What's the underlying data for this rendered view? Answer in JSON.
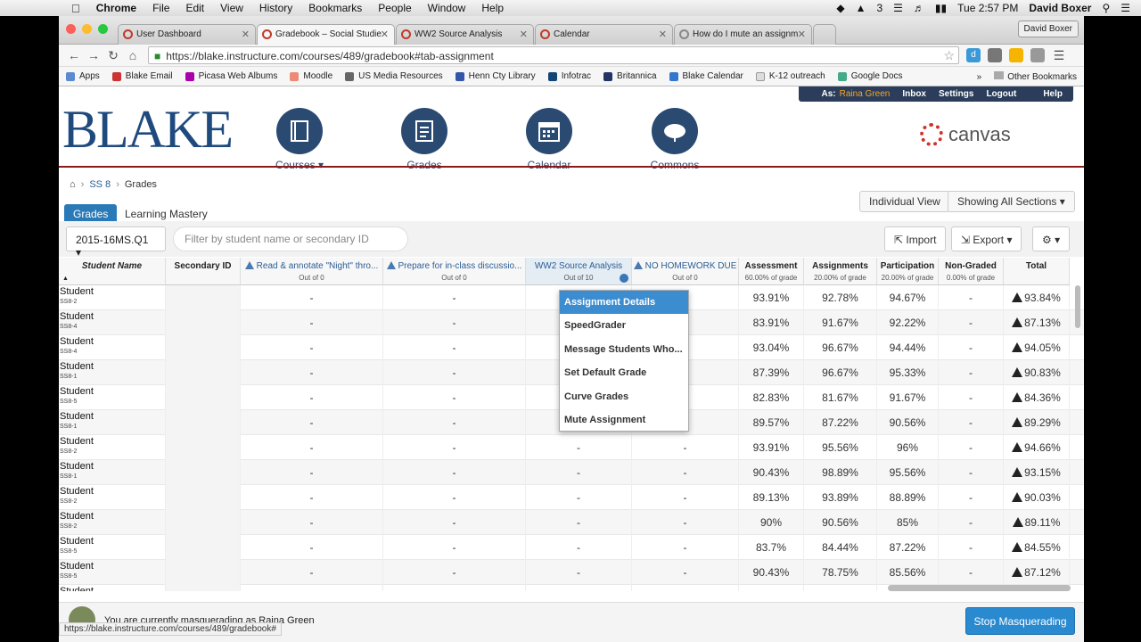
{
  "menubar": {
    "app": "Chrome",
    "items": [
      "File",
      "Edit",
      "View",
      "History",
      "Bookmarks",
      "People",
      "Window",
      "Help"
    ],
    "badge": "3",
    "clock": "Tue 2:57 PM",
    "user": "David Boxer"
  },
  "browser": {
    "tabs": [
      {
        "label": "User Dashboard"
      },
      {
        "label": "Gradebook – Social Studie"
      },
      {
        "label": "WW2 Source Analysis"
      },
      {
        "label": "Calendar"
      },
      {
        "label": "How do I mute an assignm"
      }
    ],
    "profile": "David Boxer",
    "url": "https://blake.instructure.com/courses/489/gradebook#tab-assignment",
    "bookmarks": [
      "Apps",
      "Blake Email",
      "Picasa Web Albums",
      "Moodle",
      "US Media Resources",
      "Henn Cty Library",
      "Infotrac",
      "Britannica",
      "Blake Calendar",
      "K-12 outreach",
      "Google Docs"
    ],
    "more_bookmarks": "»",
    "other_bookmarks": "Other Bookmarks",
    "status_url": "https://blake.instructure.com/courses/489/gradebook#"
  },
  "topnav": {
    "as_label": "As:",
    "as_name": "Raina Green",
    "links": [
      "Inbox",
      "Settings",
      "Logout",
      "Help"
    ]
  },
  "header": {
    "logo": "BLAKE",
    "nav": [
      {
        "label": "Courses",
        "icon": "courses-icon"
      },
      {
        "label": "Grades",
        "icon": "grades-icon"
      },
      {
        "label": "Calendar",
        "icon": "calendar-icon"
      },
      {
        "label": "Commons",
        "icon": "commons-icon"
      }
    ],
    "brand": "canvas",
    "colors": {
      "brand_navy": "#2a4a72",
      "header_rule": "#8b1a1a",
      "accent_blue": "#2a7ab8"
    }
  },
  "breadcrumb": {
    "course": "SS 8",
    "page": "Grades"
  },
  "view": {
    "grades_tab": "Grades",
    "mastery_tab": "Learning Mastery",
    "individual_view": "Individual View",
    "sections": "Showing All Sections"
  },
  "filters": {
    "term": "2015-16MS.Q1",
    "search_placeholder": "Filter by student name or secondary ID",
    "import": "Import",
    "export": "Export"
  },
  "grid": {
    "columns": [
      {
        "title": "Student Name",
        "sub": ""
      },
      {
        "title": "Secondary ID",
        "sub": ""
      },
      {
        "title": "Read & annotate \"Night\" thro...",
        "sub": "Out of 0"
      },
      {
        "title": "Prepare for in-class discussio...",
        "sub": "Out of 0"
      },
      {
        "title": "WW2 Source Analysis",
        "sub": "Out of 10"
      },
      {
        "title": "NO HOMEWORK DUE",
        "sub": "Out of 0"
      },
      {
        "title": "Assessment",
        "sub": "60.00% of grade"
      },
      {
        "title": "Assignments",
        "sub": "20.00% of grade"
      },
      {
        "title": "Participation",
        "sub": "20.00% of grade"
      },
      {
        "title": "Non-Graded",
        "sub": "0.00% of grade"
      },
      {
        "title": "Total",
        "sub": ""
      }
    ],
    "rows": [
      {
        "name": "Student",
        "section": "SS8-2",
        "a1": "-",
        "a2": "-",
        "a3": "",
        "a4": "",
        "assess": "93.91%",
        "assign": "92.78%",
        "part": "94.67%",
        "ng": "-",
        "total": "93.84%"
      },
      {
        "name": "Student",
        "section": "SS8-4",
        "a1": "-",
        "a2": "-",
        "a3": "",
        "a4": "",
        "assess": "83.91%",
        "assign": "91.67%",
        "part": "92.22%",
        "ng": "-",
        "total": "87.13%"
      },
      {
        "name": "Student",
        "section": "SS8-4",
        "a1": "-",
        "a2": "-",
        "a3": "",
        "a4": "",
        "assess": "93.04%",
        "assign": "96.67%",
        "part": "94.44%",
        "ng": "-",
        "total": "94.05%"
      },
      {
        "name": "Student",
        "section": "SS8-1",
        "a1": "-",
        "a2": "-",
        "a3": "",
        "a4": "",
        "assess": "87.39%",
        "assign": "96.67%",
        "part": "95.33%",
        "ng": "-",
        "total": "90.83%"
      },
      {
        "name": "Student",
        "section": "SS8-5",
        "a1": "-",
        "a2": "-",
        "a3": "",
        "a4": "",
        "assess": "82.83%",
        "assign": "81.67%",
        "part": "91.67%",
        "ng": "-",
        "total": "84.36%"
      },
      {
        "name": "Student",
        "section": "SS8-1",
        "a1": "-",
        "a2": "-",
        "a3": "",
        "a4": "",
        "assess": "89.57%",
        "assign": "87.22%",
        "part": "90.56%",
        "ng": "-",
        "total": "89.29%"
      },
      {
        "name": "Student",
        "section": "SS8-2",
        "a1": "-",
        "a2": "-",
        "a3": "-",
        "a4": "-",
        "assess": "93.91%",
        "assign": "95.56%",
        "part": "96%",
        "ng": "-",
        "total": "94.66%"
      },
      {
        "name": "Student",
        "section": "SS8-1",
        "a1": "-",
        "a2": "-",
        "a3": "-",
        "a4": "-",
        "assess": "90.43%",
        "assign": "98.89%",
        "part": "95.56%",
        "ng": "-",
        "total": "93.15%"
      },
      {
        "name": "Student",
        "section": "SS8-2",
        "a1": "-",
        "a2": "-",
        "a3": "-",
        "a4": "-",
        "assess": "89.13%",
        "assign": "93.89%",
        "part": "88.89%",
        "ng": "-",
        "total": "90.03%"
      },
      {
        "name": "Student",
        "section": "SS8-2",
        "a1": "-",
        "a2": "-",
        "a3": "-",
        "a4": "-",
        "assess": "90%",
        "assign": "90.56%",
        "part": "85%",
        "ng": "-",
        "total": "89.11%"
      },
      {
        "name": "Student",
        "section": "SS8-5",
        "a1": "-",
        "a2": "-",
        "a3": "-",
        "a4": "-",
        "assess": "83.7%",
        "assign": "84.44%",
        "part": "87.22%",
        "ng": "-",
        "total": "84.55%"
      },
      {
        "name": "Student",
        "section": "SS8-5",
        "a1": "-",
        "a2": "-",
        "a3": "-",
        "a4": "-",
        "assess": "90.43%",
        "assign": "78.75%",
        "part": "85.56%",
        "ng": "-",
        "total": "87.12%"
      },
      {
        "name": "Student",
        "section": "",
        "a1": "",
        "a2": "",
        "a3": "",
        "a4": "",
        "assess": "",
        "assign": "",
        "part": "",
        "ng": "",
        "total": ""
      }
    ]
  },
  "dropdown": {
    "items": [
      "Assignment Details",
      "SpeedGrader",
      "Message Students Who...",
      "Set Default Grade",
      "Curve Grades",
      "Mute Assignment"
    ]
  },
  "masquerade": {
    "text": "You are currently masquerading as Raina Green",
    "stop": "Stop Masquerading"
  }
}
